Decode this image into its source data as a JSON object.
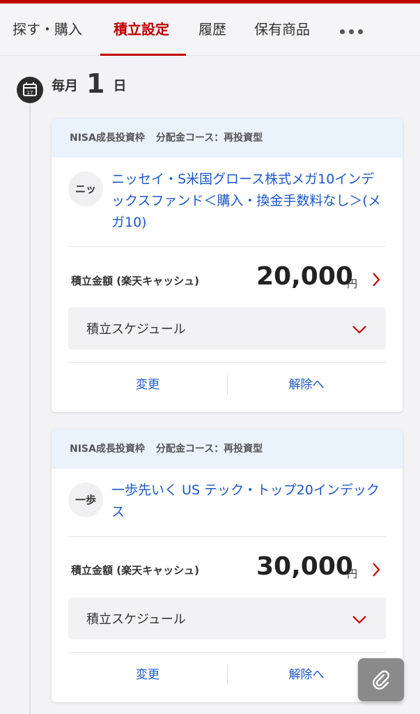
{
  "nav": {
    "tabs": [
      {
        "label": "探す・購入"
      },
      {
        "label": "積立設定"
      },
      {
        "label": "履歴"
      },
      {
        "label": "保有商品"
      }
    ],
    "active_tab": "積立設定",
    "more_icon": "more-horizontal-icon"
  },
  "schedule_day": {
    "prefix": "毎月",
    "day": "1",
    "suffix": "日",
    "icon": "calendar-icon"
  },
  "plans": [
    {
      "account": "NISA成長投資枠",
      "course": "分配金コース：再投資型",
      "fund_badge": "ニッ",
      "fund_name": "ニッセイ・S米国グロース株式メガ10インデックスファンド＜購入・換金手数料なし＞(メガ10)",
      "amount_label": "積立金額 (楽天キャッシュ)",
      "amount": "20,000",
      "unit": "円",
      "schedule_label": "積立スケジュール",
      "change_label": "変更",
      "cancel_label": "解除へ"
    },
    {
      "account": "NISA成長投資枠",
      "course": "分配金コース：再投資型",
      "fund_badge": "一歩",
      "fund_name": "一歩先いく US テック・トップ20インデックス",
      "amount_label": "積立金額 (楽天キャッシュ)",
      "amount": "30,000",
      "unit": "円",
      "schedule_label": "積立スケジュール",
      "change_label": "変更",
      "cancel_label": "解除へ"
    }
  ],
  "colors": {
    "brand": "#bf0000",
    "link": "#1c58c8",
    "card_header": "#eaf3fc",
    "background": "#f3f3f5"
  },
  "fab_icon": "paperclip-icon"
}
